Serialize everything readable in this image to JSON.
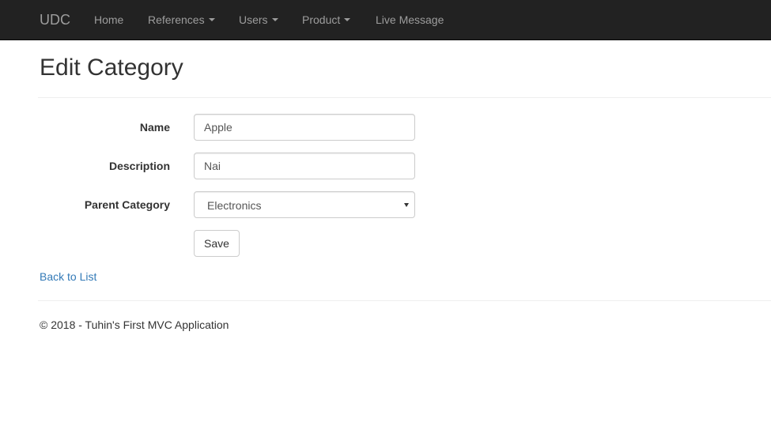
{
  "navbar": {
    "brand": "UDC",
    "items": [
      {
        "label": "Home",
        "dropdown": false
      },
      {
        "label": "References",
        "dropdown": true
      },
      {
        "label": "Users",
        "dropdown": true
      },
      {
        "label": "Product",
        "dropdown": true
      },
      {
        "label": "Live Message",
        "dropdown": false
      }
    ]
  },
  "page": {
    "title": "Edit Category"
  },
  "form": {
    "name_label": "Name",
    "name_value": "Apple",
    "description_label": "Description",
    "description_value": "Nai",
    "parent_label": "Parent Category",
    "parent_value": "Electronics",
    "save_label": "Save"
  },
  "links": {
    "back": "Back to List"
  },
  "footer": {
    "text": "© 2018 - Tuhin's First MVC Application"
  },
  "colors": {
    "navbar_bg": "#222222",
    "navbar_text": "#9d9d9d",
    "link": "#337ab7"
  }
}
